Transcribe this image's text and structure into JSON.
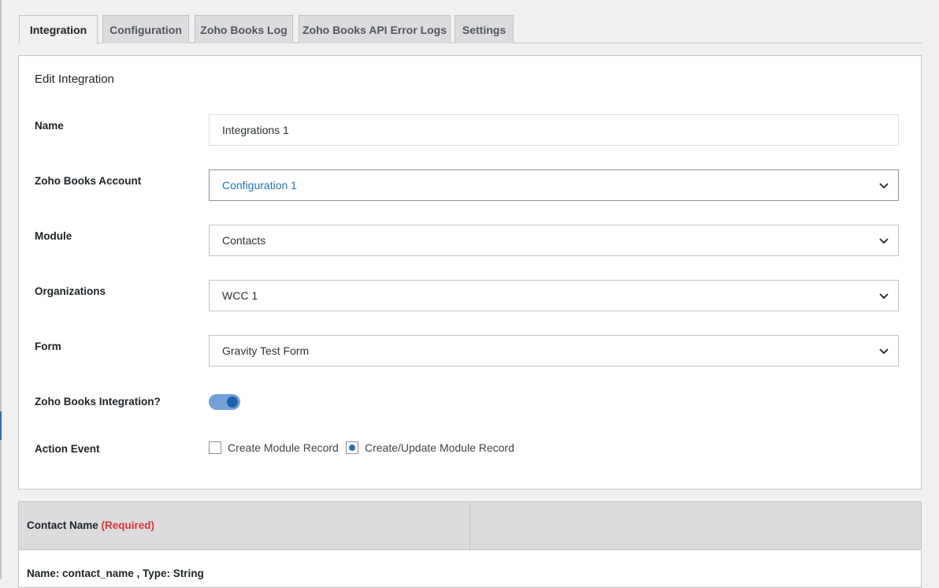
{
  "tabs": [
    {
      "label": "Integration",
      "active": true
    },
    {
      "label": "Configuration",
      "active": false
    },
    {
      "label": "Zoho Books Log",
      "active": false
    },
    {
      "label": "Zoho Books API Error Logs",
      "active": false
    },
    {
      "label": "Settings",
      "active": false
    }
  ],
  "panel": {
    "title": "Edit Integration",
    "name_label": "Name",
    "name_value": "Integrations 1",
    "account_label": "Zoho Books Account",
    "account_value": "Configuration 1",
    "module_label": "Module",
    "module_value": "Contacts",
    "org_label": "Organizations",
    "org_value": "WCC 1",
    "form_label": "Form",
    "form_value": "Gravity Test Form",
    "integration_label": "Zoho Books Integration?",
    "integration_enabled": true,
    "action_label": "Action Event",
    "action_options": [
      {
        "label": "Create Module Record",
        "selected": false
      },
      {
        "label": "Create/Update Module Record",
        "selected": true
      }
    ]
  },
  "mapping_table": {
    "header_field": "Contact Name",
    "header_required": "(Required)",
    "row_text": "Name: contact_name , Type: String"
  },
  "colors": {
    "accent": "#2271b1",
    "required": "#d63638",
    "toggle_track": "#72a0d6"
  }
}
